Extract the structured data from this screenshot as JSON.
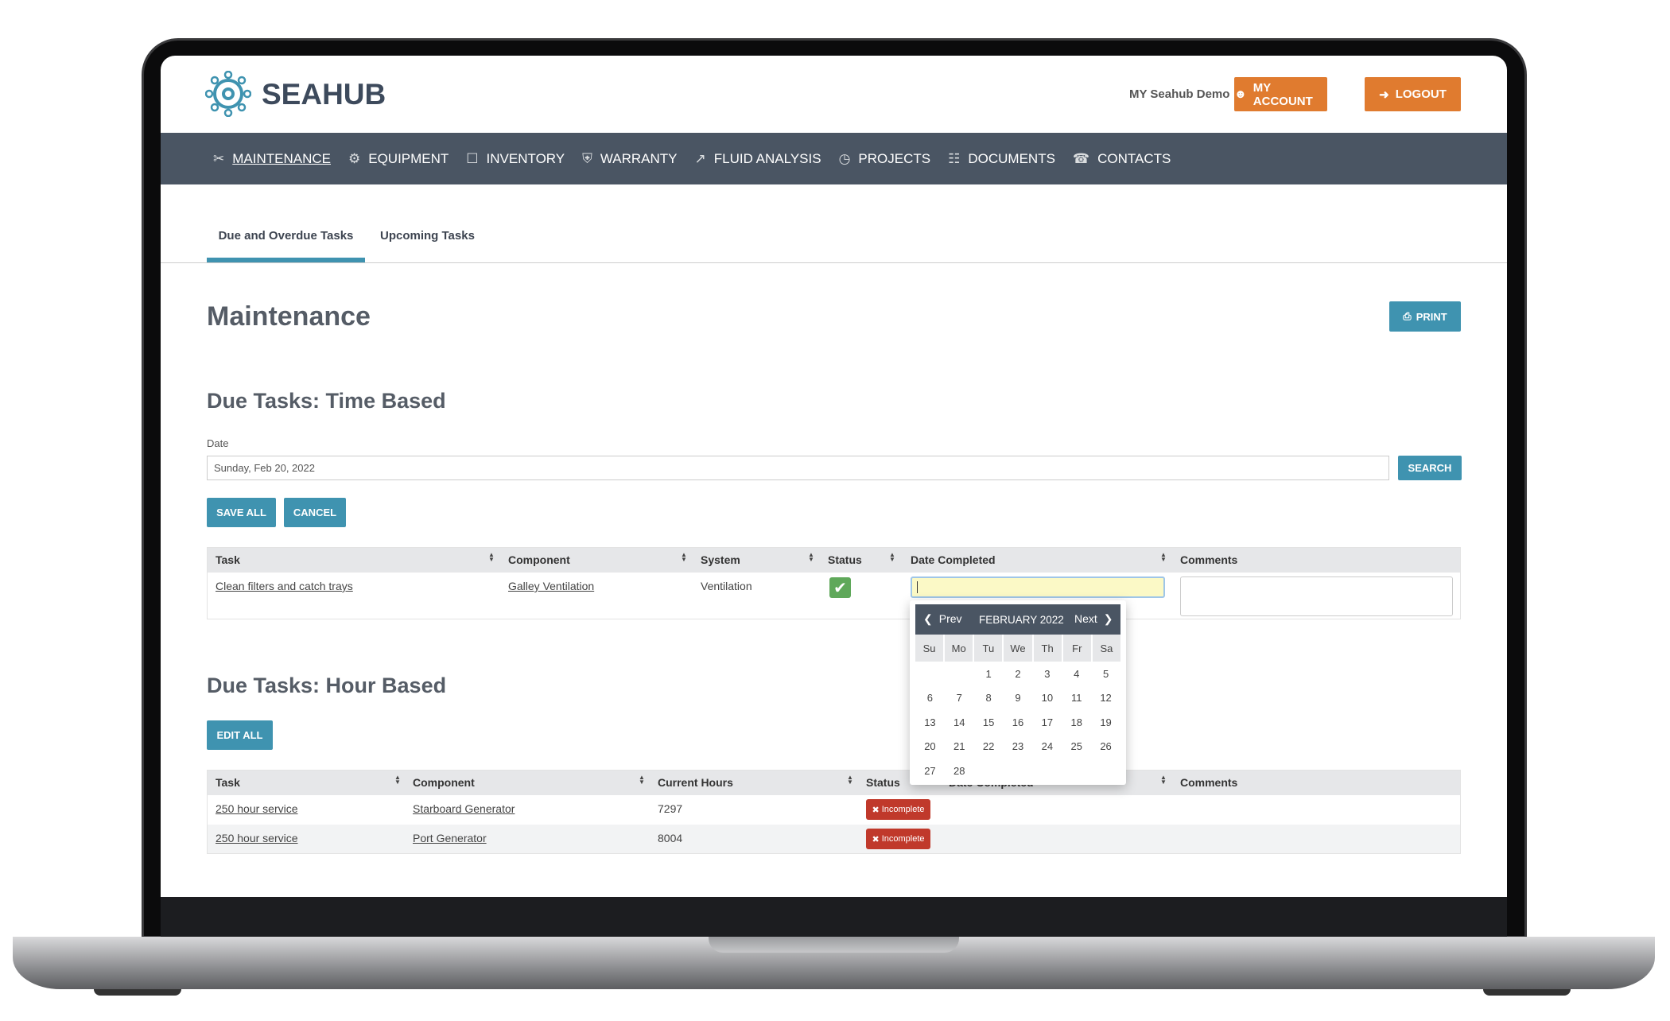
{
  "header": {
    "brand": "SEAHUB",
    "user": "MY Seahub Demo",
    "my_account": "MY ACCOUNT",
    "logout": "LOGOUT"
  },
  "nav": [
    {
      "label": "MAINTENANCE",
      "icon": "tools-icon"
    },
    {
      "label": "EQUIPMENT",
      "icon": "equipment-icon"
    },
    {
      "label": "INVENTORY",
      "icon": "inventory-icon"
    },
    {
      "label": "WARRANTY",
      "icon": "shield-icon"
    },
    {
      "label": "FLUID ANALYSIS",
      "icon": "chart-icon"
    },
    {
      "label": "PROJECTS",
      "icon": "projects-icon"
    },
    {
      "label": "DOCUMENTS",
      "icon": "document-icon"
    },
    {
      "label": "CONTACTS",
      "icon": "contacts-icon"
    }
  ],
  "tabs": [
    "Due and Overdue Tasks",
    "Upcoming Tasks"
  ],
  "page": {
    "title": "Maintenance",
    "print": "PRINT"
  },
  "time_based": {
    "title": "Due Tasks: Time Based",
    "date_label": "Date",
    "date_value": "Sunday, Feb 20, 2022",
    "search": "SEARCH",
    "save_all": "SAVE ALL",
    "cancel": "CANCEL",
    "columns": [
      "Task",
      "Component",
      "System",
      "Status",
      "Date Completed",
      "Comments"
    ],
    "rows": [
      {
        "task": "Clean filters and catch trays",
        "component": "Galley Ventilation",
        "system": "Ventilation",
        "status": "complete",
        "date_completed": "",
        "comments": ""
      }
    ]
  },
  "calendar": {
    "prev": "Prev",
    "next": "Next",
    "month": "FEBRUARY 2022",
    "dow": [
      "Su",
      "Mo",
      "Tu",
      "We",
      "Th",
      "Fr",
      "Sa"
    ],
    "first_weekday": 2,
    "days": 28
  },
  "hour_based": {
    "title": "Due Tasks: Hour Based",
    "edit_all": "EDIT ALL",
    "columns": [
      "Task",
      "Component",
      "Current Hours",
      "Status",
      "Date Completed",
      "Comments"
    ],
    "rows": [
      {
        "task": "250 hour service",
        "component": "Starboard Generator",
        "hours": "7297",
        "status": "Incomplete"
      },
      {
        "task": "250 hour service",
        "component": "Port Generator",
        "hours": "8004",
        "status": "Incomplete"
      }
    ]
  },
  "colors": {
    "accent": "#3f93b0",
    "orange": "#e07b2f",
    "nav": "#4a5563",
    "incomplete": "#c0392b",
    "complete": "#5fa85a"
  }
}
